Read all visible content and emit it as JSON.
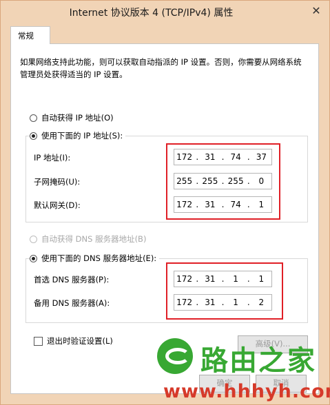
{
  "window": {
    "title": "Internet 协议版本 4 (TCP/IPv4) 属性",
    "close_glyph": "✕"
  },
  "tab": {
    "label": "常规"
  },
  "description": "如果网络支持此功能，则可以获取自动指派的 IP 设置。否则，你需要从网络系统管理员处获得适当的 IP 设置。",
  "ip_section": {
    "auto_option": "自动获得 IP 地址(O)",
    "manual_option": "使用下面的 IP 地址(S):",
    "selected": "manual",
    "fields": [
      {
        "label": "IP 地址(I):",
        "octets": [
          "172",
          "31",
          "74",
          "37"
        ]
      },
      {
        "label": "子网掩码(U):",
        "octets": [
          "255",
          "255",
          "255",
          "0"
        ]
      },
      {
        "label": "默认网关(D):",
        "octets": [
          "172",
          "31",
          "74",
          "1"
        ]
      }
    ]
  },
  "dns_section": {
    "auto_option": "自动获得 DNS 服务器地址(B)",
    "manual_option": "使用下面的 DNS 服务器地址(E):",
    "selected": "manual",
    "fields": [
      {
        "label": "首选 DNS 服务器(P):",
        "octets": [
          "172",
          "31",
          "1",
          "1"
        ]
      },
      {
        "label": "备用 DNS 服务器(A):",
        "octets": [
          "172",
          "31",
          "1",
          "2"
        ]
      }
    ]
  },
  "validate_checkbox": {
    "label": "退出时验证设置(L)",
    "checked": false
  },
  "buttons": {
    "advanced": "高级(V)...",
    "ok": "确定",
    "cancel": "取消"
  },
  "watermark": {
    "brand": "路由之家",
    "url": "www.hhhyh.com"
  },
  "colors": {
    "highlight": "#e01f26",
    "watermark_green": "#38a833",
    "watermark_red": "#d63a2a"
  }
}
